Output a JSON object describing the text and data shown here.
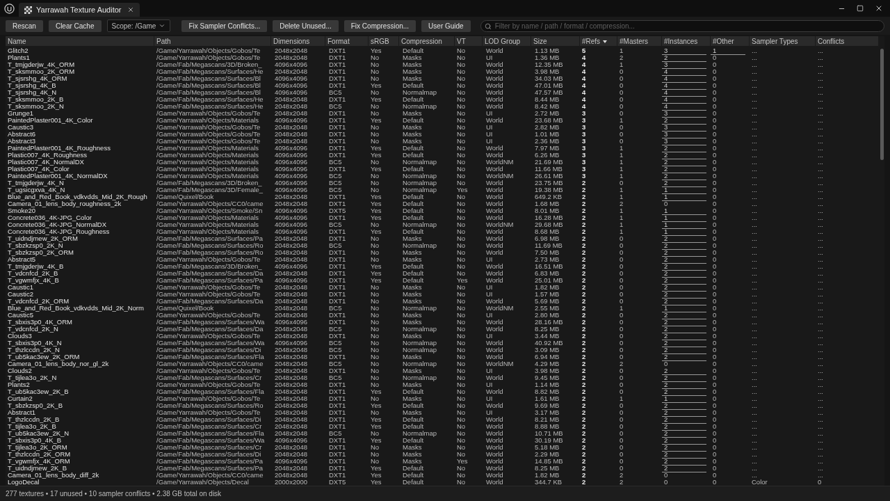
{
  "window": {
    "tab_title": "Yarrawah Texture Auditor"
  },
  "toolbar": {
    "buttons": [
      "Rescan",
      "Clear Cache"
    ],
    "scope": "Scope: /Game",
    "actions": [
      "Fix Sampler Conflicts...",
      "Delete Unused...",
      "Fix Compression...",
      "User Guide"
    ],
    "search": {
      "placeholder": "Filter by name / path / format / compression..."
    }
  },
  "table": {
    "columns": [
      {
        "label": "Name"
      },
      {
        "label": "Path"
      },
      {
        "label": "Dimensions"
      },
      {
        "label": "Format"
      },
      {
        "label": "sRGB"
      },
      {
        "label": "Compression"
      },
      {
        "label": "VT"
      },
      {
        "label": "LOD Group"
      },
      {
        "label": "Size"
      },
      {
        "label": "#Refs",
        "sorted": true,
        "bold": true
      },
      {
        "label": "#Masters"
      },
      {
        "label": "#Instances"
      },
      {
        "label": "#Other"
      },
      {
        "label": "Sampler Types"
      },
      {
        "label": "Conflicts"
      }
    ],
    "rows": [
      {
        "cells": [
          "Glitch2",
          "/Game/Yarrawah/Objects/Gobos/Te",
          "2048x2048",
          "DXT1",
          "Yes",
          "Default",
          "No",
          "World",
          "1.13 MB",
          "5",
          "1",
          "3",
          "1",
          "...",
          "..."
        ],
        "instances_link": true,
        "other_link": true
      },
      {
        "cells": [
          "Plants1",
          "/Game/Yarrawah/Objects/Gobos/Te",
          "2048x2048",
          "DXT1",
          "No",
          "Masks",
          "No",
          "UI",
          "1.36 MB",
          "4",
          "2",
          "2",
          "0",
          "...",
          "..."
        ],
        "instances_link": true,
        "other_link": false
      },
      {
        "cells": [
          "T_tmjgderjw_4K_ORM",
          "/Game/Fab/Megascans/3D/Broken_",
          "4096x4096",
          "DXT1",
          "No",
          "Masks",
          "No",
          "World",
          "12.35 MB",
          "4",
          "1",
          "3",
          "0",
          "...",
          "..."
        ],
        "instances_link": true,
        "other_link": false
      },
      {
        "cells": [
          "T_sksmmoo_2K_ORM",
          "/Game/Fab/Megascans/Surfaces/He",
          "2048x2048",
          "DXT1",
          "No",
          "Masks",
          "No",
          "World",
          "3.98 MB",
          "4",
          "0",
          "4",
          "0",
          "...",
          "..."
        ],
        "instances_link": true,
        "other_link": false
      },
      {
        "cells": [
          "T_sjsrshg_4K_ORM",
          "/Game/Fab/Megascans/Surfaces/Bl",
          "4096x4096",
          "DXT1",
          "No",
          "Masks",
          "No",
          "World",
          "34.03 MB",
          "4",
          "0",
          "4",
          "0",
          "...",
          "..."
        ],
        "instances_link": true,
        "other_link": false
      },
      {
        "cells": [
          "T_sjsrshg_4K_B",
          "/Game/Fab/Megascans/Surfaces/Bl",
          "4096x4096",
          "DXT1",
          "Yes",
          "Default",
          "No",
          "World",
          "47.01 MB",
          "4",
          "0",
          "4",
          "0",
          "...",
          "..."
        ],
        "instances_link": true,
        "other_link": false
      },
      {
        "cells": [
          "T_sjsrshg_4K_N",
          "/Game/Fab/Megascans/Surfaces/Bl",
          "4096x4096",
          "BC5",
          "No",
          "Normalmap",
          "No",
          "World",
          "47.57 MB",
          "4",
          "0",
          "4",
          "0",
          "...",
          "..."
        ],
        "instances_link": true,
        "other_link": false
      },
      {
        "cells": [
          "T_sksmmoo_2K_B",
          "/Game/Fab/Megascans/Surfaces/He",
          "2048x2048",
          "DXT1",
          "Yes",
          "Default",
          "No",
          "World",
          "8.44 MB",
          "4",
          "0",
          "4",
          "0",
          "...",
          "..."
        ],
        "instances_link": true,
        "other_link": false
      },
      {
        "cells": [
          "T_sksmmoo_2K_N",
          "/Game/Fab/Megascans/Surfaces/He",
          "2048x2048",
          "BC5",
          "No",
          "Normalmap",
          "No",
          "World",
          "8.42 MB",
          "4",
          "0",
          "4",
          "0",
          "...",
          "..."
        ],
        "instances_link": true,
        "other_link": false
      },
      {
        "cells": [
          "Grunge1",
          "/Game/Yarrawah/Objects/Gobos/Te",
          "2048x2048",
          "DXT1",
          "No",
          "Masks",
          "No",
          "UI",
          "2.72 MB",
          "3",
          "0",
          "3",
          "0",
          "...",
          "..."
        ],
        "instances_link": true,
        "other_link": false
      },
      {
        "cells": [
          "PaintedPlaster001_4K_Color",
          "/Game/Yarrawah/Objects/Materials",
          "4096x4096",
          "DXT1",
          "Yes",
          "Default",
          "No",
          "World",
          "23.68 MB",
          "3",
          "1",
          "2",
          "0",
          "...",
          "..."
        ],
        "instances_link": true,
        "other_link": false
      },
      {
        "cells": [
          "Caustic3",
          "/Game/Yarrawah/Objects/Gobos/Te",
          "2048x2048",
          "DXT1",
          "No",
          "Masks",
          "No",
          "UI",
          "2.82 MB",
          "3",
          "0",
          "3",
          "0",
          "...",
          "..."
        ],
        "instances_link": true,
        "other_link": false
      },
      {
        "cells": [
          "Abstract6",
          "/Game/Yarrawah/Objects/Gobos/Te",
          "2048x2048",
          "DXT1",
          "No",
          "Masks",
          "No",
          "UI",
          "1.01 MB",
          "3",
          "0",
          "3",
          "0",
          "...",
          "..."
        ],
        "instances_link": true,
        "other_link": false
      },
      {
        "cells": [
          "Abstract3",
          "/Game/Yarrawah/Objects/Gobos/Te",
          "2048x2048",
          "DXT1",
          "No",
          "Masks",
          "No",
          "UI",
          "2.36 MB",
          "3",
          "0",
          "3",
          "0",
          "...",
          "..."
        ],
        "instances_link": true,
        "other_link": false
      },
      {
        "cells": [
          "PaintedPlaster001_4K_Roughness",
          "/Game/Yarrawah/Objects/Materials",
          "4096x4096",
          "DXT1",
          "Yes",
          "Default",
          "No",
          "World",
          "7.97 MB",
          "3",
          "1",
          "2",
          "0",
          "...",
          "..."
        ],
        "instances_link": true,
        "other_link": false
      },
      {
        "cells": [
          "Plastic007_4K_Roughness",
          "/Game/Yarrawah/Objects/Materials",
          "4096x4096",
          "DXT1",
          "Yes",
          "Default",
          "No",
          "World",
          "6.26 MB",
          "3",
          "1",
          "2",
          "0",
          "...",
          "..."
        ],
        "instances_link": true,
        "other_link": false
      },
      {
        "cells": [
          "Plastic007_4K_NormalDX",
          "/Game/Yarrawah/Objects/Materials",
          "4096x4096",
          "BC5",
          "No",
          "Normalmap",
          "No",
          "WorldNM",
          "21.69 MB",
          "3",
          "1",
          "2",
          "0",
          "...",
          "..."
        ],
        "instances_link": true,
        "other_link": false
      },
      {
        "cells": [
          "Plastic007_4K_Color",
          "/Game/Yarrawah/Objects/Materials",
          "4096x4096",
          "DXT1",
          "Yes",
          "Default",
          "No",
          "World",
          "11.66 MB",
          "3",
          "1",
          "2",
          "0",
          "...",
          "..."
        ],
        "instances_link": true,
        "other_link": false
      },
      {
        "cells": [
          "PaintedPlaster001_4K_NormalDX",
          "/Game/Yarrawah/Objects/Materials",
          "4096x4096",
          "BC5",
          "No",
          "Normalmap",
          "No",
          "WorldNM",
          "26.61 MB",
          "3",
          "1",
          "2",
          "0",
          "...",
          "..."
        ],
        "instances_link": true,
        "other_link": false
      },
      {
        "cells": [
          "T_tmjgderjw_4K_N",
          "/Game/Fab/Megascans/3D/Broken_",
          "4096x4096",
          "BC5",
          "No",
          "Normalmap",
          "No",
          "World",
          "23.75 MB",
          "2",
          "0",
          "2",
          "0",
          "...",
          "..."
        ],
        "instances_link": true,
        "other_link": false
      },
      {
        "cells": [
          "T_ugsicgxva_4K_N",
          "/Game/Fab/Megascans/3D/Female_",
          "4096x4096",
          "BC5",
          "No",
          "Normalmap",
          "Yes",
          "World",
          "19.38 MB",
          "2",
          "1",
          "1",
          "0",
          "...",
          "..."
        ],
        "instances_link": true,
        "other_link": false
      },
      {
        "cells": [
          "Blue_and_Red_Book_vdkvdds_Mid_2K_Rough",
          "/Game/Quixel/Book",
          "2048x2048",
          "DXT1",
          "Yes",
          "Default",
          "No",
          "World",
          "649.2 KB",
          "2",
          "1",
          "1",
          "0",
          "...",
          "..."
        ],
        "instances_link": true,
        "other_link": false
      },
      {
        "cells": [
          "Camera_01_lens_body_roughness_2k",
          "/Game/Yarrawah/Objects/CC0/came",
          "2048x2048",
          "DXT1",
          "Yes",
          "Default",
          "No",
          "World",
          "1.68 MB",
          "2",
          "2",
          "0",
          "0",
          "...",
          "..."
        ],
        "instances_link": false,
        "other_link": false
      },
      {
        "cells": [
          "Smoke20",
          "/Game/Yarrawah/Objects/Smoke/Sn",
          "4096x4096",
          "DXT5",
          "Yes",
          "Default",
          "No",
          "World",
          "8.01 MB",
          "2",
          "1",
          "1",
          "0",
          "...",
          "..."
        ],
        "instances_link": true,
        "other_link": false
      },
      {
        "cells": [
          "Concrete036_4K-JPG_Color",
          "/Game/Yarrawah/Objects/Materials",
          "4096x4096",
          "DXT1",
          "Yes",
          "Default",
          "No",
          "World",
          "16.28 MB",
          "2",
          "1",
          "1",
          "0",
          "...",
          "..."
        ],
        "instances_link": true,
        "other_link": false
      },
      {
        "cells": [
          "Concrete036_4K-JPG_NormalDX",
          "/Game/Yarrawah/Objects/Materials",
          "4096x4096",
          "BC5",
          "No",
          "Normalmap",
          "No",
          "WorldNM",
          "29.68 MB",
          "2",
          "1",
          "1",
          "0",
          "...",
          "..."
        ],
        "instances_link": true,
        "other_link": false
      },
      {
        "cells": [
          "Concrete036_4K-JPG_Roughness",
          "/Game/Yarrawah/Objects/Materials",
          "4096x4096",
          "DXT1",
          "Yes",
          "Default",
          "No",
          "World",
          "8.68 MB",
          "2",
          "1",
          "1",
          "0",
          "...",
          "..."
        ],
        "instances_link": true,
        "other_link": false
      },
      {
        "cells": [
          "T_uidndjmew_2K_ORM",
          "/Game/Fab/Megascans/Surfaces/Pa",
          "2048x2048",
          "DXT1",
          "No",
          "Masks",
          "No",
          "World",
          "6.98 MB",
          "2",
          "0",
          "2",
          "0",
          "...",
          "..."
        ],
        "instances_link": true,
        "other_link": false
      },
      {
        "cells": [
          "T_sbzkzsp0_2K_N",
          "/Game/Fab/Megascans/Surfaces/Ro",
          "2048x2048",
          "BC5",
          "No",
          "Normalmap",
          "No",
          "World",
          "11.69 MB",
          "2",
          "0",
          "2",
          "0",
          "...",
          "..."
        ],
        "instances_link": true,
        "other_link": false
      },
      {
        "cells": [
          "T_sbzkzsp0_2K_ORM",
          "/Game/Fab/Megascans/Surfaces/Ro",
          "2048x2048",
          "DXT1",
          "No",
          "Masks",
          "No",
          "World",
          "7.50 MB",
          "2",
          "0",
          "2",
          "0",
          "...",
          "..."
        ],
        "instances_link": true,
        "other_link": false
      },
      {
        "cells": [
          "Abstract5",
          "/Game/Yarrawah/Objects/Gobos/Te",
          "2048x2048",
          "DXT1",
          "No",
          "Masks",
          "No",
          "UI",
          "2.73 MB",
          "2",
          "0",
          "2",
          "0",
          "...",
          "..."
        ],
        "instances_link": true,
        "other_link": false
      },
      {
        "cells": [
          "T_tmjgderjw_4K_B",
          "/Game/Fab/Megascans/3D/Broken_",
          "4096x4096",
          "DXT1",
          "Yes",
          "Default",
          "No",
          "World",
          "16.51 MB",
          "2",
          "0",
          "2",
          "0",
          "...",
          "..."
        ],
        "instances_link": true,
        "other_link": false
      },
      {
        "cells": [
          "T_vdcnfcd_2K_B",
          "/Game/Fab/Megascans/Surfaces/Da",
          "2048x2048",
          "DXT1",
          "Yes",
          "Default",
          "No",
          "World",
          "6.83 MB",
          "2",
          "0",
          "2",
          "0",
          "...",
          "..."
        ],
        "instances_link": true,
        "other_link": false
      },
      {
        "cells": [
          "T_vgwmfjx_4K_B",
          "/Game/Fab/Megascans/Surfaces/Pa",
          "4096x4096",
          "DXT1",
          "Yes",
          "Default",
          "Yes",
          "World",
          "25.01 MB",
          "2",
          "0",
          "2",
          "0",
          "...",
          "..."
        ],
        "instances_link": true,
        "other_link": false
      },
      {
        "cells": [
          "Caustic1",
          "/Game/Yarrawah/Objects/Gobos/Te",
          "2048x2048",
          "DXT1",
          "No",
          "Masks",
          "No",
          "UI",
          "1.82 MB",
          "2",
          "0",
          "2",
          "0",
          "...",
          "..."
        ],
        "instances_link": true,
        "other_link": false
      },
      {
        "cells": [
          "Caustic2",
          "/Game/Yarrawah/Objects/Gobos/Te",
          "2048x2048",
          "DXT1",
          "No",
          "Masks",
          "No",
          "UI",
          "1.57 MB",
          "2",
          "0",
          "2",
          "0",
          "...",
          "..."
        ],
        "instances_link": true,
        "other_link": false
      },
      {
        "cells": [
          "T_vdcnfcd_2K_ORM",
          "/Game/Fab/Megascans/Surfaces/Da",
          "2048x2048",
          "DXT1",
          "No",
          "Masks",
          "No",
          "World",
          "5.69 MB",
          "2",
          "0",
          "2",
          "0",
          "...",
          "..."
        ],
        "instances_link": true,
        "other_link": false
      },
      {
        "cells": [
          "Blue_and_Red_Book_vdkvdds_Mid_2K_Norm",
          "/Game/Quixel/Book",
          "2048x2048",
          "BC5",
          "No",
          "Normalmap",
          "No",
          "WorldNM",
          "2.55 MB",
          "2",
          "1",
          "1",
          "0",
          "...",
          "..."
        ],
        "instances_link": true,
        "other_link": false
      },
      {
        "cells": [
          "Caustic5",
          "/Game/Yarrawah/Objects/Gobos/Te",
          "2048x2048",
          "DXT1",
          "No",
          "Masks",
          "No",
          "UI",
          "2.80 MB",
          "2",
          "0",
          "2",
          "0",
          "...",
          "..."
        ],
        "instances_link": true,
        "other_link": false
      },
      {
        "cells": [
          "T_sbxis3p0_4K_ORM",
          "/Game/Fab/Megascans/Surfaces/Wa",
          "4096x4096",
          "DXT1",
          "No",
          "Masks",
          "No",
          "World",
          "28.16 MB",
          "2",
          "0",
          "2",
          "0",
          "...",
          "..."
        ],
        "instances_link": true,
        "other_link": false
      },
      {
        "cells": [
          "T_vdcnfcd_2K_N",
          "/Game/Fab/Megascans/Surfaces/Da",
          "2048x2048",
          "BC5",
          "No",
          "Normalmap",
          "No",
          "World",
          "8.25 MB",
          "2",
          "0",
          "2",
          "0",
          "...",
          "..."
        ],
        "instances_link": true,
        "other_link": false
      },
      {
        "cells": [
          "Clouds3",
          "/Game/Yarrawah/Objects/Gobos/Te",
          "2048x2048",
          "DXT1",
          "No",
          "Masks",
          "No",
          "UI",
          "3.44 MB",
          "2",
          "0",
          "2",
          "0",
          "...",
          "..."
        ],
        "instances_link": true,
        "other_link": false
      },
      {
        "cells": [
          "T_sbxis3p0_4K_N",
          "/Game/Fab/Megascans/Surfaces/Wa",
          "4096x4096",
          "BC5",
          "No",
          "Normalmap",
          "No",
          "World",
          "40.92 MB",
          "2",
          "0",
          "2",
          "0",
          "...",
          "..."
        ],
        "instances_link": true,
        "other_link": false
      },
      {
        "cells": [
          "T_thzlccdn_2K_N",
          "/Game/Fab/Megascans/Surfaces/Di",
          "2048x2048",
          "BC5",
          "No",
          "Normalmap",
          "No",
          "World",
          "3.09 MB",
          "2",
          "0",
          "2",
          "0",
          "...",
          "..."
        ],
        "instances_link": true,
        "other_link": false
      },
      {
        "cells": [
          "T_ub5kac3ew_2K_ORM",
          "/Game/Fab/Megascans/Surfaces/Fla",
          "2048x2048",
          "DXT1",
          "No",
          "Masks",
          "No",
          "World",
          "6.94 MB",
          "2",
          "0",
          "2",
          "0",
          "...",
          "..."
        ],
        "instances_link": true,
        "other_link": false
      },
      {
        "cells": [
          "Camera_01_lens_body_nor_gl_2k",
          "/Game/Yarrawah/Objects/CC0/came",
          "2048x2048",
          "BC5",
          "No",
          "Normalmap",
          "No",
          "WorldNM",
          "4.29 MB",
          "2",
          "2",
          "0",
          "0",
          "...",
          "..."
        ],
        "instances_link": false,
        "other_link": false
      },
      {
        "cells": [
          "Clouds2",
          "/Game/Yarrawah/Objects/Gobos/Te",
          "2048x2048",
          "DXT1",
          "No",
          "Masks",
          "No",
          "UI",
          "3.98 MB",
          "2",
          "0",
          "2",
          "0",
          "...",
          "..."
        ],
        "instances_link": true,
        "other_link": false
      },
      {
        "cells": [
          "T_tijlea3o_2K_N",
          "/Game/Fab/Megascans/Surfaces/Cr",
          "2048x2048",
          "BC5",
          "No",
          "Normalmap",
          "No",
          "World",
          "9.45 MB",
          "2",
          "0",
          "2",
          "0",
          "...",
          "..."
        ],
        "instances_link": true,
        "other_link": false
      },
      {
        "cells": [
          "Plants2",
          "/Game/Yarrawah/Objects/Gobos/Te",
          "2048x2048",
          "DXT1",
          "No",
          "Masks",
          "No",
          "UI",
          "1.14 MB",
          "2",
          "0",
          "2",
          "0",
          "...",
          "..."
        ],
        "instances_link": true,
        "other_link": false
      },
      {
        "cells": [
          "T_ub5kac3ew_2K_B",
          "/Game/Fab/Megascans/Surfaces/Fla",
          "2048x2048",
          "DXT1",
          "Yes",
          "Default",
          "No",
          "World",
          "8.82 MB",
          "2",
          "0",
          "2",
          "0",
          "...",
          "..."
        ],
        "instances_link": true,
        "other_link": false
      },
      {
        "cells": [
          "Curtain2",
          "/Game/Yarrawah/Objects/Gobos/Te",
          "2048x2048",
          "DXT1",
          "No",
          "Masks",
          "No",
          "UI",
          "1.61 MB",
          "2",
          "1",
          "1",
          "0",
          "...",
          "..."
        ],
        "instances_link": true,
        "other_link": false
      },
      {
        "cells": [
          "T_sbzkzsp0_2K_B",
          "/Game/Fab/Megascans/Surfaces/Ro",
          "2048x2048",
          "DXT1",
          "Yes",
          "Default",
          "No",
          "World",
          "9.69 MB",
          "2",
          "0",
          "2",
          "0",
          "...",
          "..."
        ],
        "instances_link": true,
        "other_link": false
      },
      {
        "cells": [
          "Abstract1",
          "/Game/Yarrawah/Objects/Gobos/Te",
          "2048x2048",
          "DXT1",
          "No",
          "Masks",
          "No",
          "UI",
          "3.17 MB",
          "2",
          "0",
          "2",
          "0",
          "...",
          "..."
        ],
        "instances_link": true,
        "other_link": false
      },
      {
        "cells": [
          "T_thzlccdn_2K_B",
          "/Game/Fab/Megascans/Surfaces/Di",
          "2048x2048",
          "DXT1",
          "Yes",
          "Default",
          "No",
          "World",
          "8.21 MB",
          "2",
          "0",
          "2",
          "0",
          "...",
          "..."
        ],
        "instances_link": true,
        "other_link": false
      },
      {
        "cells": [
          "T_tijlea3o_2K_B",
          "/Game/Fab/Megascans/Surfaces/Cr",
          "2048x2048",
          "DXT1",
          "Yes",
          "Default",
          "No",
          "World",
          "8.88 MB",
          "2",
          "0",
          "2",
          "0",
          "...",
          "..."
        ],
        "instances_link": true,
        "other_link": false
      },
      {
        "cells": [
          "T_ub5kac3ew_2K_N",
          "/Game/Fab/Megascans/Surfaces/Fla",
          "2048x2048",
          "BC5",
          "No",
          "Normalmap",
          "No",
          "World",
          "10.71 MB",
          "2",
          "0",
          "2",
          "0",
          "...",
          "..."
        ],
        "instances_link": true,
        "other_link": false
      },
      {
        "cells": [
          "T_sbxis3p0_4K_B",
          "/Game/Fab/Megascans/Surfaces/Wa",
          "4096x4096",
          "DXT1",
          "Yes",
          "Default",
          "No",
          "World",
          "30.19 MB",
          "2",
          "0",
          "2",
          "0",
          "...",
          "..."
        ],
        "instances_link": true,
        "other_link": false
      },
      {
        "cells": [
          "T_tijlea3o_2K_ORM",
          "/Game/Fab/Megascans/Surfaces/Cr",
          "2048x2048",
          "DXT1",
          "No",
          "Masks",
          "No",
          "World",
          "5.18 MB",
          "2",
          "0",
          "2",
          "0",
          "...",
          "..."
        ],
        "instances_link": true,
        "other_link": false
      },
      {
        "cells": [
          "T_thzlccdn_2K_ORM",
          "/Game/Fab/Megascans/Surfaces/Di",
          "2048x2048",
          "DXT1",
          "No",
          "Masks",
          "No",
          "World",
          "2.29 MB",
          "2",
          "0",
          "2",
          "0",
          "...",
          "..."
        ],
        "instances_link": true,
        "other_link": false
      },
      {
        "cells": [
          "T_vgwmfjx_4K_ORM",
          "/Game/Fab/Megascans/Surfaces/Pa",
          "4096x4096",
          "DXT1",
          "No",
          "Masks",
          "Yes",
          "World",
          "14.85 MB",
          "2",
          "0",
          "2",
          "0",
          "...",
          "..."
        ],
        "instances_link": true,
        "other_link": false
      },
      {
        "cells": [
          "T_uidndjmew_2K_B",
          "/Game/Fab/Megascans/Surfaces/Pa",
          "2048x2048",
          "DXT1",
          "Yes",
          "Default",
          "No",
          "World",
          "8.25 MB",
          "2",
          "0",
          "2",
          "0",
          "...",
          "..."
        ],
        "instances_link": true,
        "other_link": false
      },
      {
        "cells": [
          "Camera_01_lens_body_diff_2k",
          "/Game/Yarrawah/Objects/CC0/came",
          "2048x2048",
          "DXT1",
          "Yes",
          "Default",
          "No",
          "World",
          "1.82 MB",
          "2",
          "2",
          "0",
          "0",
          "...",
          "..."
        ],
        "instances_link": false,
        "other_link": false
      },
      {
        "cells": [
          "LogoDecal",
          "/Game/Yarrawah/Objects/Decal",
          "2000x2000",
          "DXT5",
          "Yes",
          "Default",
          "No",
          "World",
          "344.7 KB",
          "2",
          "2",
          "0",
          "0",
          "Color",
          "0"
        ],
        "instances_link": false,
        "other_link": false
      }
    ]
  },
  "status_bar": "277 textures • 17 unused • 10 sampler conflicts • 2.38 GB total on disk"
}
